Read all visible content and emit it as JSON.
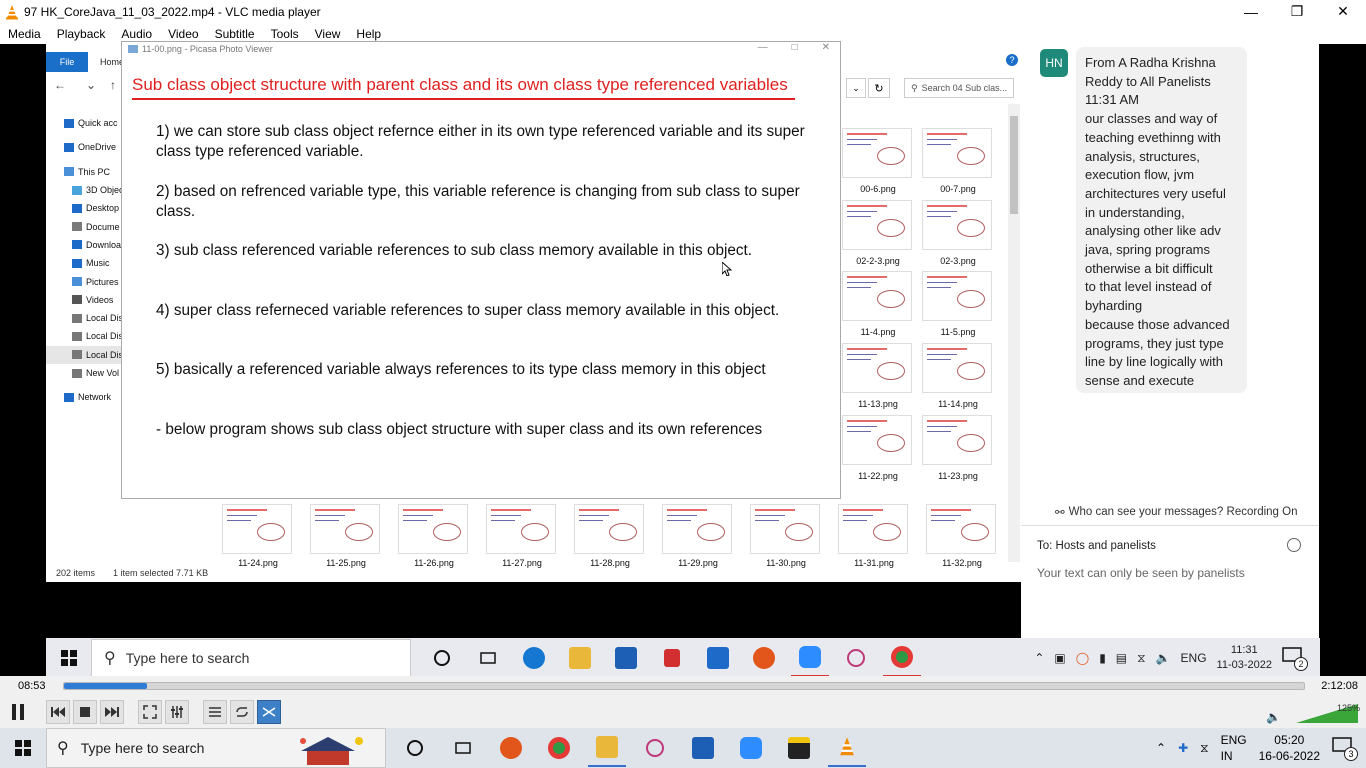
{
  "vlc": {
    "window_title": "97 HK_CoreJava_11_03_2022.mp4 - VLC media player",
    "menu": [
      "Media",
      "Playback",
      "Audio",
      "Video",
      "Subtitle",
      "Tools",
      "View",
      "Help"
    ],
    "controls": {
      "elapsed": "08:53",
      "total": "2:12:08",
      "progress_fraction": 0.067,
      "volume_label": "125%",
      "volume_fraction": 1.0
    }
  },
  "explorer": {
    "ribbon_file": "File",
    "ribbon_home": "Home",
    "search_placeholder": "Search 04 Sub clas...",
    "tree": [
      {
        "label": "Quick acc",
        "icon": "star-icon"
      },
      {
        "label": "OneDrive",
        "icon": "cloud-icon"
      },
      {
        "label": "This PC",
        "icon": "computer-icon"
      },
      {
        "label": "3D Objec",
        "icon": "cube-icon"
      },
      {
        "label": "Desktop",
        "icon": "desktop-icon"
      },
      {
        "label": "Docume",
        "icon": "document-icon"
      },
      {
        "label": "Downloa",
        "icon": "download-icon"
      },
      {
        "label": "Music",
        "icon": "music-icon"
      },
      {
        "label": "Pictures",
        "icon": "picture-icon"
      },
      {
        "label": "Videos",
        "icon": "video-icon"
      },
      {
        "label": "Local Dis",
        "icon": "drive-icon"
      },
      {
        "label": "Local Dis",
        "icon": "drive-icon"
      },
      {
        "label": "Local Dis",
        "icon": "drive-icon"
      },
      {
        "label": "New Vol",
        "icon": "drive-icon"
      },
      {
        "label": "Network",
        "icon": "network-icon"
      }
    ],
    "thumbnails": [
      "00-6.png",
      "00-7.png",
      "02-2-3.png",
      "02-3.png",
      "11-4.png",
      "11-5.png",
      "11-13.png",
      "11-14.png",
      "11-22.png",
      "11-23.png"
    ],
    "bottom_thumbnails": [
      "11-24.png",
      "11-25.png",
      "11-26.png",
      "11-27.png",
      "11-28.png",
      "11-29.png",
      "11-30.png",
      "11-31.png",
      "11-32.png"
    ],
    "status": {
      "count": "202 items",
      "selected": "1 item selected  7.71 KB"
    }
  },
  "picasa": {
    "window_title": "11-00.png - Picasa Photo Viewer",
    "slide_title": "Sub class object structure with parent class and its own class type referenced variables",
    "points": [
      "1) we can store sub class object refernce either in its own type referenced variable and its super class type referenced variable.",
      "2) based on refrenced variable type, this variable reference is changing from sub class to super class.",
      "3) sub class referenced variable references to sub class memory available in this object.",
      "4) super class referneced variable references to super class memory available in this object.",
      "5) basically a referenced variable always references to its type class memory in this object",
      "- below program shows sub class object structure with super class and its own references"
    ]
  },
  "chat": {
    "avatar_initials": "HN",
    "message_lines": [
      "From A Radha Krishna",
      "Reddy to All Panelists",
      "11:31 AM",
      "our classes and way of",
      "teaching evethinng with",
      "analysis, structures,",
      "execution flow, jvm",
      "architectures very useful",
      "in understanding,",
      "analysing other like adv",
      "java, spring programs",
      "otherwise a bit difficult",
      "to that level instead of",
      "byharding",
      "because those advanced",
      "programs, they just type",
      "line by line logically with",
      "sense and execute"
    ],
    "privacy_notice": "Who can see your messages? Recording On",
    "to_label": "To:  Hosts and panelists",
    "input_placeholder": "Your text can only be seen by panelists"
  },
  "inner_taskbar": {
    "search_placeholder": "Type here to search",
    "lang": "ENG",
    "time": "11:31",
    "date": "11-03-2022",
    "notifications": "2"
  },
  "taskbar": {
    "search_placeholder": "Type here to search",
    "lang_top": "ENG",
    "lang_bottom": "IN",
    "time": "05:20",
    "date": "16-06-2022",
    "notifications": "3"
  },
  "colors": {
    "slide_title": "#e02020",
    "vlc_seek": "#2e7cd6",
    "zoom_avatar": "#1f8a7a"
  }
}
